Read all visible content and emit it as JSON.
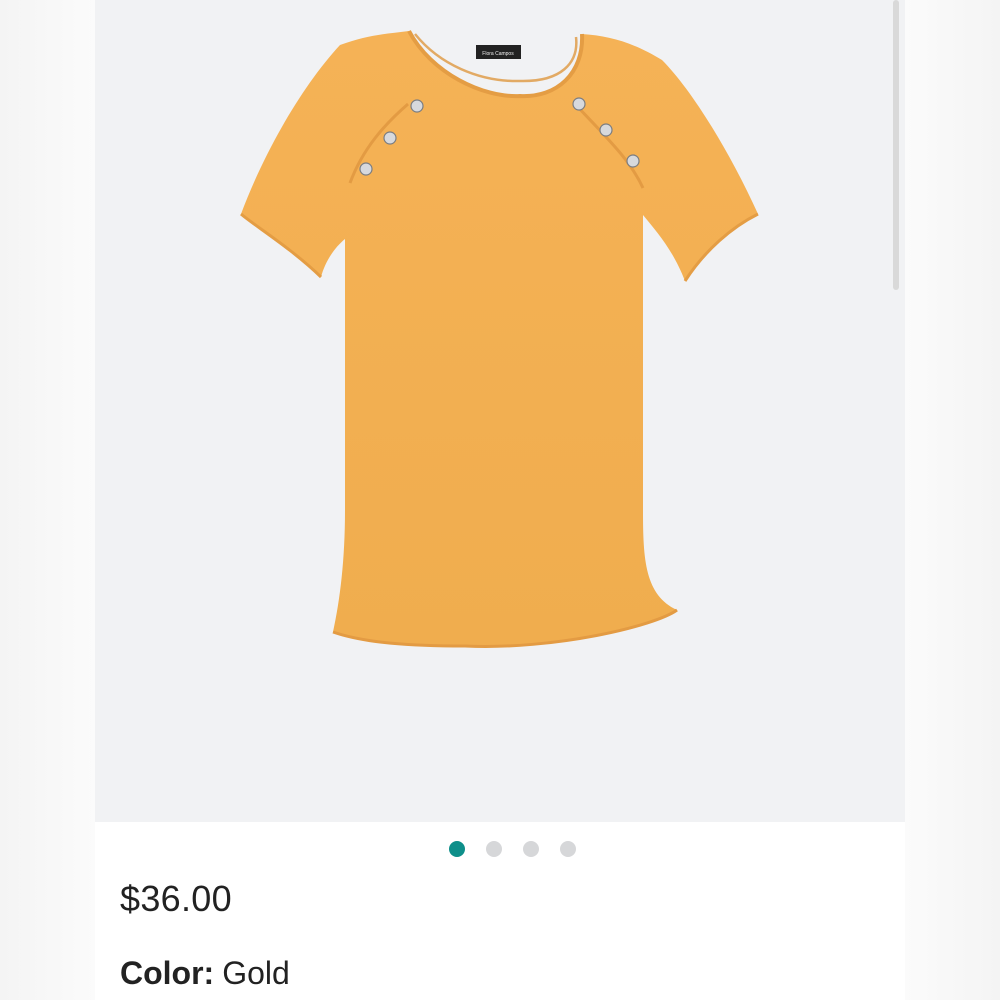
{
  "product": {
    "brand_tag": "Flora Campos",
    "price": "$36.00",
    "color_label": "Color:",
    "color_value": "Gold",
    "image_alt": "Gold short-sleeve tee with button shoulder detail"
  },
  "carousel": {
    "dots": [
      "slide-1",
      "slide-2",
      "slide-3",
      "slide-4"
    ],
    "active_index": 0
  },
  "colors": {
    "shirt": "#f2ad4f",
    "shirt_shadow": "#e59d3f",
    "accent": "#0e8f8a",
    "background": "#f1f2f4"
  }
}
